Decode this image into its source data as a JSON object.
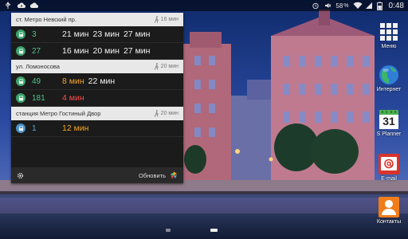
{
  "status_bar": {
    "left_icons": [
      "usb-icon",
      "cloud-upload-icon",
      "cloud-icon"
    ],
    "battery": "58",
    "time": "0:48"
  },
  "widget": {
    "stops": [
      {
        "name": "ст. Метро Невский пр.",
        "walk": "16 мин",
        "routes": [
          {
            "number": "3",
            "type": "green",
            "times": [
              {
                "text": "21 мин",
                "color": "white"
              },
              {
                "text": "23 мин",
                "color": "white"
              },
              {
                "text": "27 мин",
                "color": "white"
              }
            ]
          },
          {
            "number": "27",
            "type": "green",
            "times": [
              {
                "text": "16 мин",
                "color": "white"
              },
              {
                "text": "20 мин",
                "color": "white"
              },
              {
                "text": "27 мин",
                "color": "white"
              }
            ]
          }
        ]
      },
      {
        "name": "ул. Ломоносова",
        "walk": "20 мин",
        "routes": [
          {
            "number": "49",
            "type": "green",
            "times": [
              {
                "text": "8 мин",
                "color": "orange"
              },
              {
                "text": "22 мин",
                "color": "white"
              }
            ]
          },
          {
            "number": "181",
            "type": "green",
            "times": [
              {
                "text": "4 мин",
                "color": "red"
              }
            ]
          }
        ]
      },
      {
        "name": "станция Метро Гостиный Двор",
        "walk": "20 мин",
        "routes": [
          {
            "number": "1",
            "type": "blue",
            "times": [
              {
                "text": "12 мин",
                "color": "orange"
              }
            ]
          }
        ]
      }
    ],
    "footer": {
      "refresh_label": "Обновить"
    }
  },
  "dock": {
    "menu_label": "Меню",
    "internet_label": "Интернет",
    "planner_label": "S Planner",
    "planner_day": "31",
    "email_label": "E-mail",
    "contacts_label": "Контакты"
  },
  "colors": {
    "route_green": "#3aa36b",
    "route_blue": "#4a90c8",
    "time_orange": "#f5a623",
    "time_red": "#ff4b4b",
    "email_red": "#d9342b",
    "contacts_orange": "#f07c1a"
  }
}
